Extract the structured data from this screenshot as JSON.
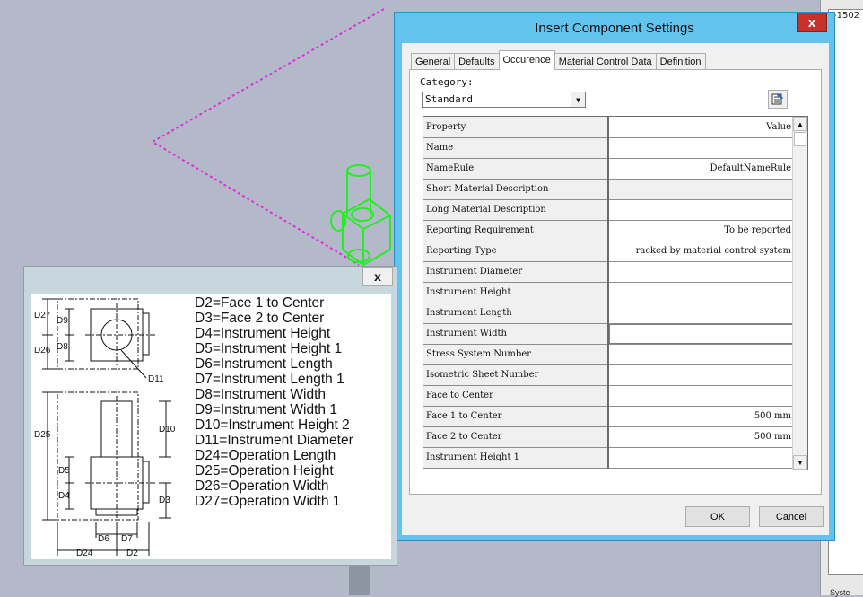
{
  "dialog": {
    "title": "Insert Component Settings",
    "close_glyph": "x",
    "tabs": [
      {
        "label": "General",
        "active": false
      },
      {
        "label": "Defaults",
        "active": false
      },
      {
        "label": "Occurence",
        "active": true
      },
      {
        "label": "Material Control Data",
        "active": false
      },
      {
        "label": "Definition",
        "active": false
      }
    ],
    "category_label": "Category:",
    "category_value": "Standard",
    "properties_icon": "properties-icon",
    "grid": {
      "header_property": "Property",
      "header_value": "Value",
      "rows": [
        {
          "name": "Name",
          "value": ""
        },
        {
          "name": "NameRule",
          "value": "DefaultNameRule"
        },
        {
          "name": "Short Material Description",
          "value": "",
          "disabled": true
        },
        {
          "name": "Long Material Description",
          "value": ""
        },
        {
          "name": "Reporting Requirement",
          "value": "To be reported"
        },
        {
          "name": "Reporting Type",
          "value": "racked by material control system"
        },
        {
          "name": "Instrument Diameter",
          "value": ""
        },
        {
          "name": "Instrument Height",
          "value": ""
        },
        {
          "name": "Instrument Length",
          "value": ""
        },
        {
          "name": "Instrument Width",
          "value": "",
          "editing": true
        },
        {
          "name": "Stress System Number",
          "value": ""
        },
        {
          "name": "Isometric Sheet Number",
          "value": ""
        },
        {
          "name": "Face to Center",
          "value": ""
        },
        {
          "name": "Face 1 to Center",
          "value": "500 mm"
        },
        {
          "name": "Face 2 to Center",
          "value": "500 mm"
        },
        {
          "name": "Instrument Height 1",
          "value": ""
        }
      ]
    },
    "ok_label": "OK",
    "cancel_label": "Cancel"
  },
  "preview": {
    "close_glyph": "x",
    "legend": [
      "D2=Face 1 to Center",
      "D3=Face 2 to Center",
      "D4=Instrument Height",
      "D5=Instrument Height 1",
      "D6=Instrument Length",
      "D7=Instrument Length 1",
      "D8=Instrument Width",
      "D9=Instrument Width 1",
      "D10=Instrument Height 2",
      "D11=Instrument Diameter",
      "D24=Operation Length",
      "D25=Operation Height",
      "D26=Operation Width",
      "D27=Operation Width 1"
    ],
    "dimension_labels": {
      "d27": "D27",
      "d9": "D9",
      "d26": "D26",
      "d8": "D8",
      "d11": "D11",
      "d25": "D25",
      "d10": "D10",
      "d5": "D5",
      "d4": "D4",
      "d3": "D3",
      "d6": "D6",
      "d7": "D7",
      "d24": "D24",
      "d2": "D2"
    }
  },
  "sidebar": {
    "ruler_label": "-1502",
    "bottom_label": "Syste"
  },
  "colors": {
    "viewport_bg": "#b3b9c8",
    "route_line": "#e02ce0",
    "component": "#22ee22",
    "dialog_frame": "#62c4ee",
    "close_red": "#c7312b"
  }
}
